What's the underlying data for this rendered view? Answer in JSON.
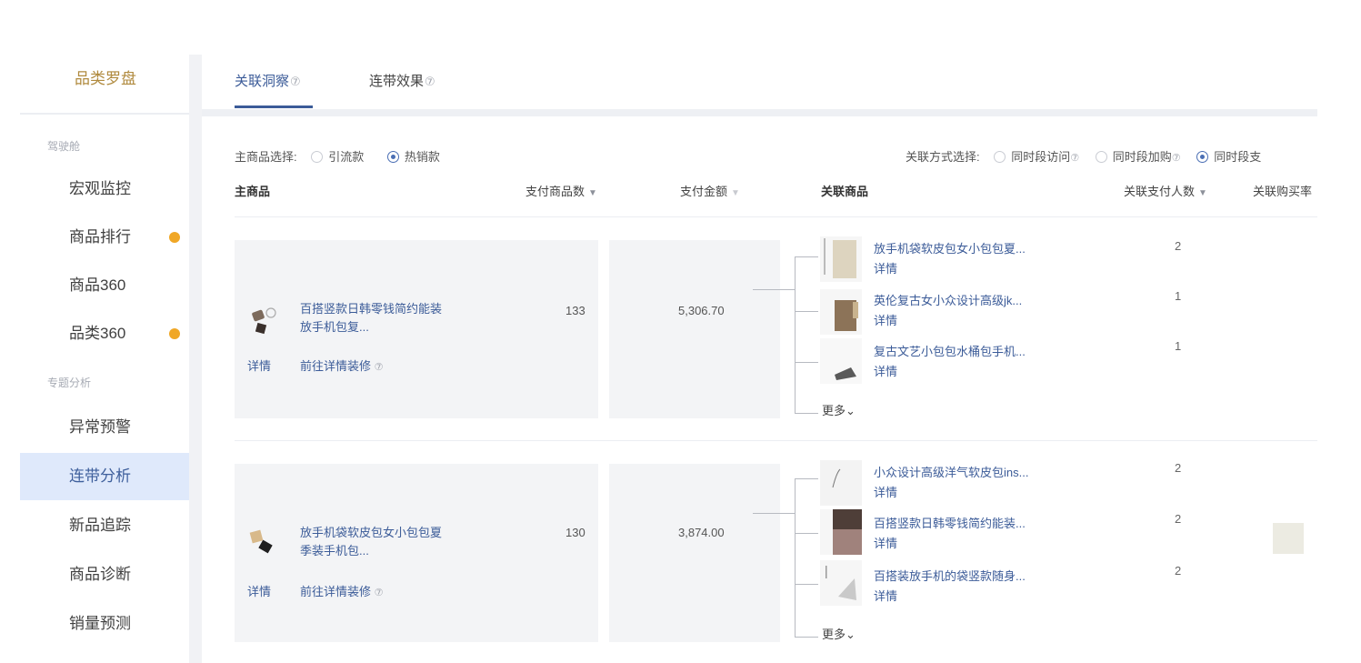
{
  "sidebar": {
    "title": "品类罗盘",
    "group1_label": "驾驶舱",
    "group2_label": "专题分析",
    "items": [
      {
        "label": "宏观监控",
        "badge": false
      },
      {
        "label": "商品排行",
        "badge": true
      },
      {
        "label": "商品360",
        "badge": false
      },
      {
        "label": "品类360",
        "badge": true
      },
      {
        "label": "异常预警",
        "badge": false
      },
      {
        "label": "连带分析",
        "badge": false,
        "active": true
      },
      {
        "label": "新品追踪",
        "badge": false
      },
      {
        "label": "商品诊断",
        "badge": false
      },
      {
        "label": "销量预测",
        "badge": false
      }
    ]
  },
  "tabs": [
    {
      "label": "关联洞察",
      "active": true
    },
    {
      "label": "连带效果",
      "active": false
    }
  ],
  "filters": {
    "main_label": "主商品选择:",
    "main_options": [
      {
        "label": "引流款",
        "selected": false
      },
      {
        "label": "热销款",
        "selected": true
      }
    ],
    "relation_label": "关联方式选择:",
    "relation_options": [
      {
        "label": "同时段访问",
        "selected": false
      },
      {
        "label": "同时段加购",
        "selected": false
      },
      {
        "label": "同时段支",
        "selected": true
      }
    ]
  },
  "table": {
    "headers": {
      "main_product": "主商品",
      "pay_count": "支付商品数",
      "pay_amount": "支付金额",
      "related_product": "关联商品",
      "related_buyers": "关联支付人数",
      "related_rate": "关联购买率"
    },
    "rows": [
      {
        "name": "百搭竖款日韩零钱简约能装放手机包复...",
        "detail": "详情",
        "decor": "前往详情装修",
        "pay_count": "133",
        "pay_amount": "5,306.70",
        "related": [
          {
            "name": "放手机袋软皮包女小包包夏...",
            "detail": "详情",
            "buyers": "2"
          },
          {
            "name": "英伦复古女小众设计高级jk...",
            "detail": "详情",
            "buyers": "1"
          },
          {
            "name": "复古文艺小包包水桶包手机...",
            "detail": "详情",
            "buyers": "1"
          }
        ],
        "more": "更多"
      },
      {
        "name": "放手机袋软皮包女小包包夏季装手机包...",
        "detail": "详情",
        "decor": "前往详情装修",
        "pay_count": "130",
        "pay_amount": "3,874.00",
        "related": [
          {
            "name": "小众设计高级洋气软皮包ins...",
            "detail": "详情",
            "buyers": "2"
          },
          {
            "name": "百搭竖款日韩零钱简约能装...",
            "detail": "详情",
            "buyers": "2"
          },
          {
            "name": "百搭装放手机的袋竖款随身...",
            "detail": "详情",
            "buyers": "2"
          }
        ],
        "more": "更多"
      }
    ]
  },
  "icons": {
    "help": "question-circle-icon",
    "sort": "sort-down-icon",
    "expand": "chevron-down-icon"
  },
  "colors": {
    "accent": "#3b5b98",
    "badge": "#f0a726",
    "active_bg": "#dfe9fb",
    "brand_title": "#b08a3e"
  }
}
